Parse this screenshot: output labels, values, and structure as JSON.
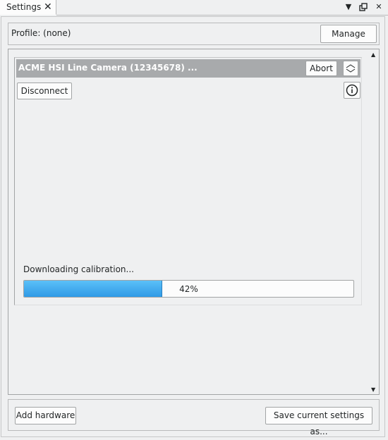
{
  "window": {
    "tab_title": "Settings",
    "tab_close_icon": "close-icon",
    "menu_icon": "chevron-down-icon",
    "float_icon": "float-icon",
    "close_icon": "close-icon"
  },
  "profile": {
    "label": "Profile:  (none)",
    "manage_label": "Manage"
  },
  "device": {
    "title": "ACME HSI Line Camera (12345678) ...",
    "abort_label": "Abort",
    "collapse_icon": "collapse-icon",
    "disconnect_label": "Disconnect",
    "info_icon": "info-icon",
    "status_text": "Downloading calibration...",
    "progress_percent": 42,
    "progress_text": "42%"
  },
  "footer": {
    "add_hardware_label": "Add hardware",
    "save_settings_label": "Save current settings as..."
  },
  "colors": {
    "header_bg": "#a8aaac",
    "progress_fill": "#3daee9",
    "background": "#eff0f1"
  }
}
